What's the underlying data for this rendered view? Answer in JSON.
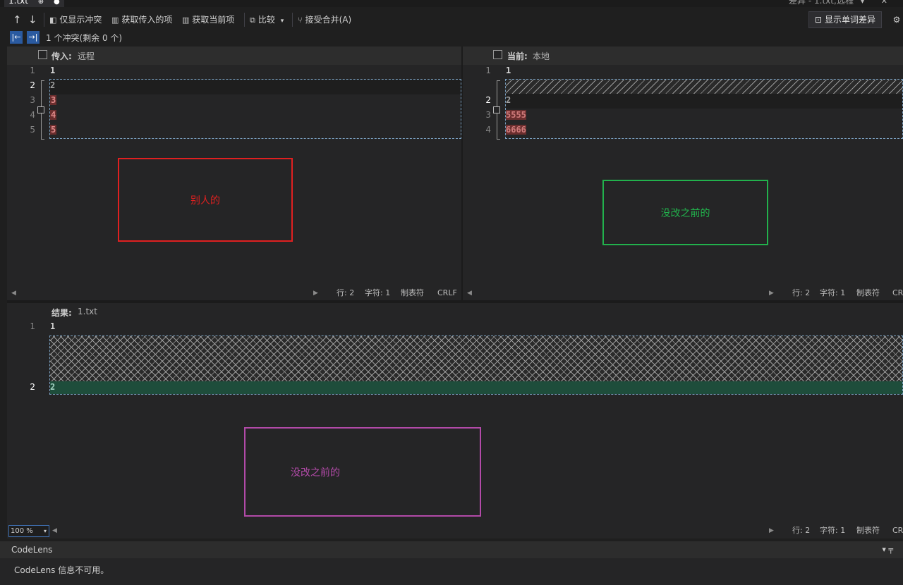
{
  "window": {
    "tab_title": "1.txt",
    "tab_pin": "⊕",
    "tab_dirty": "●",
    "title_right": "差异 - 1.txt;远程",
    "title_icons": "▾ ✕"
  },
  "toolbar": {
    "prev_conflict": "↑",
    "next_conflict": "↓",
    "only_conflicts": "仅显示冲突",
    "take_incoming": "获取传入的项",
    "take_current": "获取当前项",
    "compare": "比较",
    "compare_arrow": "▾",
    "accept_merge": "接受合并(A)",
    "show_word_diff": "显示单词差异",
    "settings": "⚙"
  },
  "conflict_bar": {
    "prev": "|←",
    "next": "→|",
    "text": "1 个冲突(剩余 0 个)"
  },
  "incoming": {
    "label": "传入:",
    "value": "远程",
    "lines": [
      {
        "num": "1",
        "text": "1"
      },
      {
        "num": "2",
        "text": "2"
      },
      {
        "num": "3",
        "text": "3"
      },
      {
        "num": "4",
        "text": "4"
      },
      {
        "num": "5",
        "text": "5"
      }
    ],
    "annotation": "别人的",
    "status": {
      "line": "行: 2",
      "char": "字符: 1",
      "tab": "制表符",
      "eol": "CRLF"
    }
  },
  "current": {
    "label": "当前:",
    "value": "本地",
    "lines": [
      {
        "num": "1",
        "text": "1"
      },
      {
        "num": "2",
        "text": "2"
      },
      {
        "num": "3",
        "text": "5555"
      },
      {
        "num": "4",
        "text": "6666"
      }
    ],
    "annotation": "没改之前的",
    "status": {
      "line": "行: 2",
      "char": "字符: 1",
      "tab": "制表符",
      "eol": "CR"
    }
  },
  "result": {
    "label": "结果:",
    "value": "1.txt",
    "lines": [
      {
        "num": "1",
        "text": "1"
      },
      {
        "num": "2",
        "text": "2"
      }
    ],
    "annotation": "没改之前的",
    "zoom": "100 %",
    "status": {
      "line": "行: 2",
      "char": "字符: 1",
      "tab": "制表符",
      "eol": "CR"
    }
  },
  "codelens": {
    "title": "CodeLens",
    "message": "CodeLens 信息不可用。",
    "pin": "▾ ╤"
  },
  "colors": {
    "annotation_red": "#e02020",
    "annotation_green": "#22b14c",
    "annotation_purple": "#b24aa8",
    "merge_green": "#1e4d3b"
  }
}
